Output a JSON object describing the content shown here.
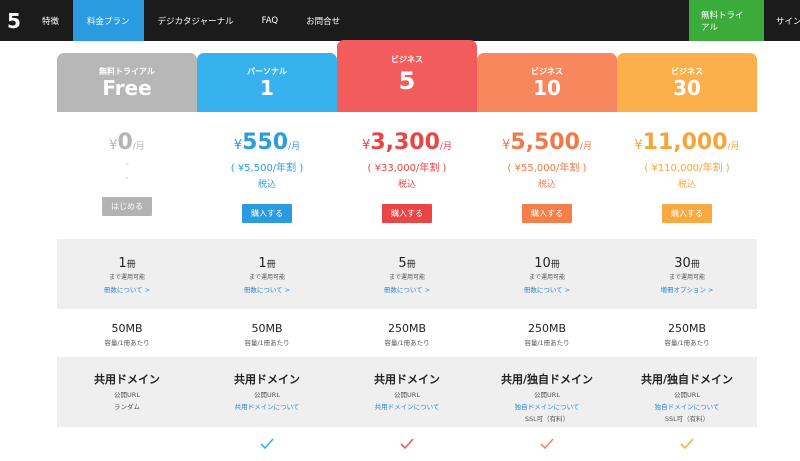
{
  "nav": {
    "logo": "5",
    "items": [
      "特徴",
      "料金プラン",
      "デジカタジャーナル",
      "FAQ",
      "お問合せ"
    ],
    "trial": "無料トライアル",
    "signin": "サインイン"
  },
  "plans": [
    {
      "label": "無料トライアル",
      "name": "Free",
      "yen": "¥",
      "price": "0",
      "unit": "/月",
      "sub1": "-",
      "sub2": "-",
      "button": "はじめる",
      "books": "1",
      "books_unit": "冊",
      "books_sub": "まで運用可能",
      "books_link": "冊数について >",
      "storage": "50MB",
      "storage_sub": "容量/1冊あたり",
      "domain": "共用ドメイン",
      "domain_sub1": "公開URL",
      "domain_sub2": "ランダム",
      "domain_link": "",
      "domain_sub3": ""
    },
    {
      "label": "パーソナル",
      "name": "1",
      "yen": "¥",
      "price": "550",
      "unit": "/月",
      "sub1": "( ¥5,500/年割 )",
      "sub2": "税込",
      "button": "購入する",
      "books": "1",
      "books_unit": "冊",
      "books_sub": "まで運用可能",
      "books_link": "冊数について >",
      "storage": "50MB",
      "storage_sub": "容量/1冊あたり",
      "domain": "共用ドメイン",
      "domain_sub1": "公開URL",
      "domain_sub2": "",
      "domain_link": "共用ドメインについて",
      "domain_sub3": ""
    },
    {
      "label": "ビジネス",
      "name": "5",
      "yen": "¥",
      "price": "3,300",
      "unit": "/月",
      "sub1": "( ¥33,000/年割 )",
      "sub2": "税込",
      "button": "購入する",
      "books": "5",
      "books_unit": "冊",
      "books_sub": "まで運用可能",
      "books_link": "冊数について >",
      "storage": "250MB",
      "storage_sub": "容量/1冊あたり",
      "domain": "共用ドメイン",
      "domain_sub1": "公開URL",
      "domain_sub2": "",
      "domain_link": "共用ドメインについて",
      "domain_sub3": ""
    },
    {
      "label": "ビジネス",
      "name": "10",
      "yen": "¥",
      "price": "5,500",
      "unit": "/月",
      "sub1": "( ¥55,000/年割 )",
      "sub2": "税込",
      "button": "購入する",
      "books": "10",
      "books_unit": "冊",
      "books_sub": "まで運用可能",
      "books_link": "冊数について >",
      "storage": "250MB",
      "storage_sub": "容量/1冊あたり",
      "domain": "共用/独自ドメイン",
      "domain_sub1": "公開URL",
      "domain_sub2": "",
      "domain_link": "独自ドメインについて",
      "domain_sub3": "SSL可（有料）"
    },
    {
      "label": "ビジネス",
      "name": "30",
      "yen": "¥",
      "price": "11,000",
      "unit": "/月",
      "sub1": "( ¥110,000/年割 )",
      "sub2": "税込",
      "button": "購入する",
      "books": "30",
      "books_unit": "冊",
      "books_sub": "まで運用可能",
      "books_link": "増冊オプション >",
      "storage": "250MB",
      "storage_sub": "容量/1冊あたり",
      "domain": "共用/独自ドメイン",
      "domain_sub1": "公開URL",
      "domain_sub2": "",
      "domain_link": "独自ドメインについて",
      "domain_sub3": "SSL可（有料）"
    }
  ],
  "colors": {
    "free": "#b7b7b7",
    "personal": "#37b2ef",
    "business5": "#f25c5c",
    "business10": "#f8875e",
    "business30": "#fbb04b",
    "trial": "#3bab3b",
    "nav_active": "#2a9be0"
  }
}
